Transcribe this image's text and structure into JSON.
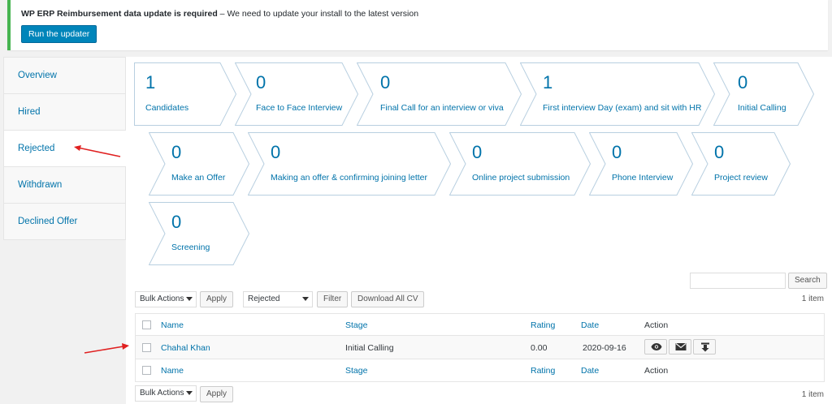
{
  "notice": {
    "title": "WP ERP Reimbursement data update is required",
    "message": " – We need to update your install to the latest version",
    "button_label": "Run the updater"
  },
  "sidebar": {
    "items": [
      {
        "label": "Overview"
      },
      {
        "label": "Hired"
      },
      {
        "label": "Rejected"
      },
      {
        "label": "Withdrawn"
      },
      {
        "label": "Declined Offer"
      }
    ]
  },
  "stages": [
    {
      "count": "1",
      "label": "Candidates"
    },
    {
      "count": "0",
      "label": "Face to Face Interview"
    },
    {
      "count": "0",
      "label": "Final Call for an interview or viva"
    },
    {
      "count": "1",
      "label": "First interview Day (exam) and sit with HR"
    },
    {
      "count": "0",
      "label": "Initial Calling"
    },
    {
      "count": "0",
      "label": "Make an Offer"
    },
    {
      "count": "0",
      "label": "Making an offer & confirming joining letter"
    },
    {
      "count": "0",
      "label": "Online project submission"
    },
    {
      "count": "0",
      "label": "Phone Interview"
    },
    {
      "count": "0",
      "label": "Project review"
    },
    {
      "count": "0",
      "label": "Screening"
    }
  ],
  "search": {
    "button_label": "Search",
    "value": ""
  },
  "toolbar": {
    "bulk_actions": "Bulk Actions",
    "apply_label": "Apply",
    "filter_status": "Rejected",
    "filter_label": "Filter",
    "download_label": "Download All CV",
    "item_count": "1 item"
  },
  "table": {
    "headers": {
      "name": "Name",
      "stage": "Stage",
      "rating": "Rating",
      "date": "Date",
      "action": "Action"
    },
    "rows": [
      {
        "name": "Chahal Khan",
        "stage": "Initial Calling",
        "rating": "0.00",
        "date": "2020-09-16"
      }
    ]
  },
  "icons": {
    "view": "eye-icon",
    "email": "envelope-icon",
    "download": "download-icon"
  },
  "colors": {
    "link": "#0073aa",
    "primary_button": "#0085ba",
    "notice_border": "#46b450",
    "annotation_arrow": "#e02020"
  }
}
